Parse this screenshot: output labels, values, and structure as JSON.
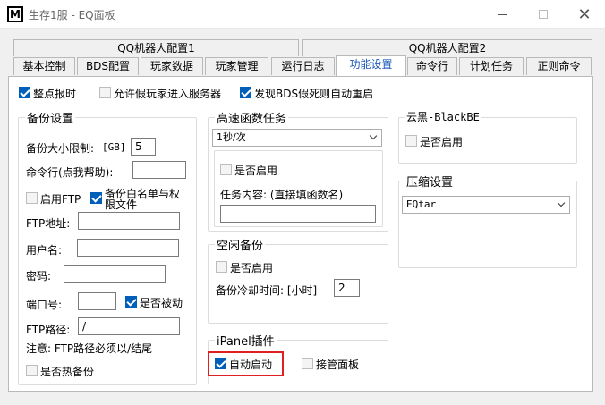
{
  "window": {
    "app_icon_letter": "M",
    "title": "生存1服 - EQ面板"
  },
  "upper_tabs": [
    "QQ机器人配置1",
    "QQ机器人配置2"
  ],
  "tabs": [
    "基本控制",
    "BDS配置",
    "玩家数据",
    "玩家管理",
    "运行日志",
    "功能设置",
    "命令行",
    "计划任务",
    "正则命令"
  ],
  "active_tab": "功能设置",
  "top_options": {
    "hourly_broadcast": "整点报时",
    "allow_fake_players": "允许假玩家进入服务器",
    "auto_restart": "发现BDS假死则自动重启"
  },
  "backup": {
    "title": "备份设置",
    "size_limit_label": "备份大小限制:",
    "size_unit": "[GB]",
    "size_value": "5",
    "command_label": "命令行(点我帮助):",
    "command_value": "",
    "enable_ftp": "启用FTP",
    "backup_whitelist": "备份白名单与权",
    "backup_whitelist_2": "限文件",
    "ftp_address_label": "FTP地址:",
    "ftp_address_value": "",
    "username_label": "用户名:",
    "username_value": "",
    "password_label": "密码:",
    "password_value": "",
    "port_label": "端口号:",
    "port_value": "",
    "passive_label": "是否被动",
    "ftp_path_label": "FTP路径:",
    "ftp_path_value": "/",
    "note": "注意: FTP路径必须以/结尾",
    "hot_backup": "是否热备份"
  },
  "fast_func": {
    "title": "高速函数任务",
    "interval_value": "1秒/次",
    "enable": "是否启用",
    "content_label": "任务内容: (直接填函数名)",
    "content_value": ""
  },
  "idle_backup": {
    "title": "空闲备份",
    "enable": "是否启用",
    "cooldown_label": "备份冷却时间: [小时]",
    "cooldown_value": "2"
  },
  "ipanel": {
    "title": "iPanel插件",
    "auto_start": "自动启动",
    "take_over": "接管面板"
  },
  "blackbe": {
    "title": "云黑-BlackBE",
    "enable": "是否启用"
  },
  "compress": {
    "title": "压缩设置",
    "value": "EQtar"
  },
  "checkbox_states": {
    "hourly_broadcast": true,
    "allow_fake_players": false,
    "auto_restart": true,
    "enable_ftp": false,
    "backup_whitelist": true,
    "passive": true,
    "hot_backup": false,
    "fast_func_enable": false,
    "idle_enable": false,
    "ipanel_auto_start": true,
    "ipanel_take_over": false,
    "blackbe_enable": false
  },
  "colors": {
    "accent": "#005fb8",
    "highlight_border": "#e02020",
    "active_tab_text": "#1a58b8"
  }
}
